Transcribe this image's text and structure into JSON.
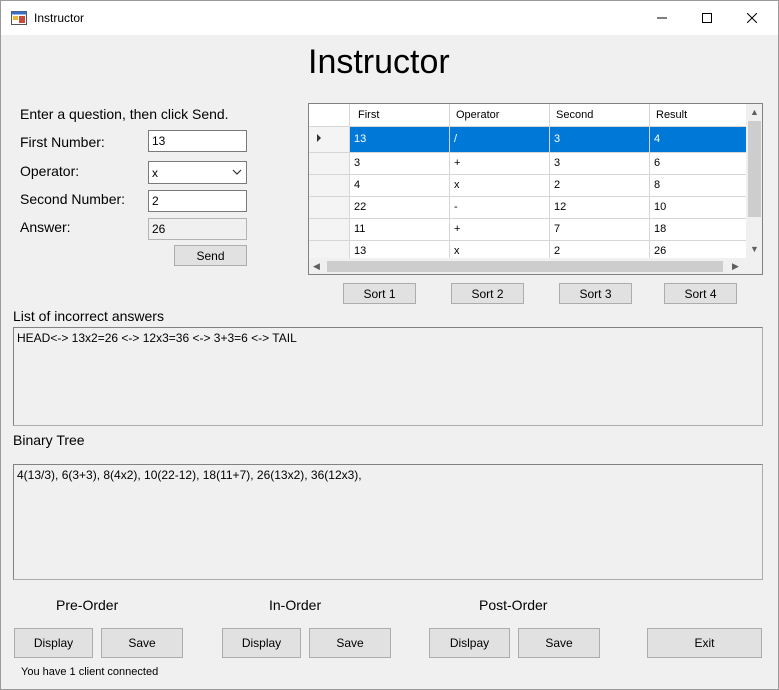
{
  "window": {
    "title": "Instructor"
  },
  "header": {
    "title": "Instructor"
  },
  "form": {
    "instruction": "Enter a question, then click Send.",
    "first_number_label": "First Number:",
    "first_number_value": "13",
    "operator_label": "Operator:",
    "operator_value": "x",
    "second_number_label": "Second Number:",
    "second_number_value": "2",
    "answer_label": "Answer:",
    "answer_value": "26",
    "send_label": "Send"
  },
  "grid": {
    "columns": [
      "First",
      "Operator",
      "Second",
      "Result"
    ],
    "rows": [
      [
        "13",
        "/",
        "3",
        "4"
      ],
      [
        "3",
        "+",
        "3",
        "6"
      ],
      [
        "4",
        "x",
        "2",
        "8"
      ],
      [
        "22",
        "-",
        "12",
        "10"
      ],
      [
        "11",
        "+",
        "7",
        "18"
      ],
      [
        "13",
        "x",
        "2",
        "26"
      ]
    ],
    "selected_row": 0
  },
  "sort_buttons": [
    "Sort 1",
    "Sort 2",
    "Sort 3",
    "Sort 4"
  ],
  "incorrect": {
    "label": "List of incorrect answers",
    "text": "HEAD<-> 13x2=26 <-> 12x3=36 <-> 3+3=6 <-> TAIL"
  },
  "tree": {
    "label": "Binary Tree",
    "text": "4(13/3), 6(3+3), 8(4x2), 10(22-12), 18(11+7), 26(13x2), 36(12x3),"
  },
  "orders": {
    "pre_label": "Pre-Order",
    "in_label": "In-Order",
    "post_label": "Post-Order",
    "pre_display": "Display",
    "pre_save": "Save",
    "in_display": "Display",
    "in_save": "Save",
    "post_display": "Dislpay",
    "post_save": "Save",
    "exit": "Exit"
  },
  "status": "You have 1 client connected",
  "colors": {
    "selection": "#0078d7",
    "background": "#f0f0f0"
  }
}
